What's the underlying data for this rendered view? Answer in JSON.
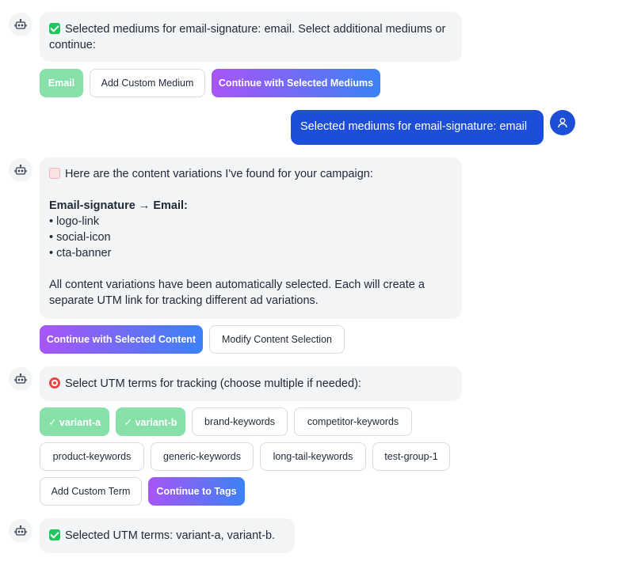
{
  "messages": {
    "m1": {
      "text": "Selected mediums for email-signature: email. Select additional mediums or continue:",
      "icon": "check-mark-icon"
    },
    "m1_buttons": {
      "email": "Email",
      "add_custom_medium": "Add Custom Medium",
      "continue_mediums": "Continue with Selected Mediums"
    },
    "user1": {
      "text": "Selected mediums for email-signature: email"
    },
    "m2": {
      "intro": "Here are the content variations I've found for your campaign:",
      "heading": "Email-signature → Email:",
      "items": [
        "• logo-link",
        "• social-icon",
        "• cta-banner"
      ],
      "note_line1": "All content variations have been automatically selected. Each will create a",
      "note_line2": "separate UTM link for tracking different ad variations.",
      "icon": "memo-icon"
    },
    "m2_buttons": {
      "continue_content": "Continue with Selected Content",
      "modify_content": "Modify Content Selection"
    },
    "m3": {
      "text": "Select UTM terms for tracking (choose multiple if needed):",
      "icon": "target-icon"
    },
    "terms": {
      "variant_a": "✓ variant-a",
      "variant_b": "✓ variant-b",
      "brand_keywords": "brand-keywords",
      "competitor_keywords": "competitor-keywords",
      "product_keywords": "product-keywords",
      "generic_keywords": "generic-keywords",
      "long_tail_keywords": "long-tail-keywords",
      "test_group_1": "test-group-1",
      "add_custom_term": "Add Custom Term",
      "continue_tags": "Continue to Tags"
    },
    "m4": {
      "text": "Selected UTM terms: variant-a, variant-b.",
      "icon": "check-mark-icon"
    }
  },
  "colors": {
    "user_bubble": "#1d4ed8",
    "bot_bubble": "#f3f4f6",
    "selected_chip": "#86e0a8",
    "gradient_start": "#a855f7",
    "gradient_end": "#3b82f6"
  }
}
